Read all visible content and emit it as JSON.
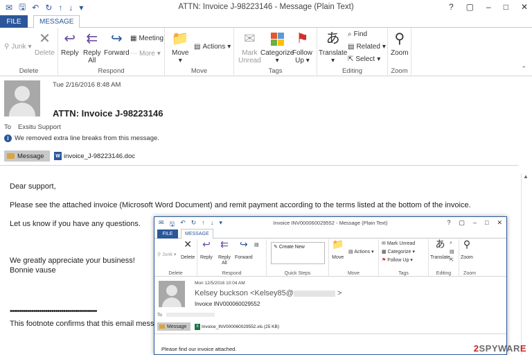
{
  "window": {
    "title": "ATTN: Invoice J-98223146 - Message (Plain Text)"
  },
  "tabs": {
    "file": "FILE",
    "message": "MESSAGE"
  },
  "window_controls": {
    "help": "?",
    "restore": "▢",
    "minimize": "–",
    "maximize": "□",
    "close": "✕"
  },
  "ribbon": {
    "delete_group": {
      "junk": "Junk",
      "delete": "Delete",
      "label": "Delete"
    },
    "respond_group": {
      "reply": "Reply",
      "reply_all_1": "Reply",
      "reply_all_2": "All",
      "forward": "Forward",
      "meeting": "Meeting",
      "more": "More",
      "label": "Respond"
    },
    "move_group": {
      "move": "Move",
      "actions": "Actions",
      "label": "Move"
    },
    "tags_group": {
      "mark_1": "Mark",
      "mark_2": "Unread",
      "categorize": "Categorize",
      "follow_1": "Follow",
      "follow_2": "Up",
      "label": "Tags"
    },
    "editing_group": {
      "translate": "Translate",
      "find": "Find",
      "related": "Related",
      "select": "Select",
      "label": "Editing"
    },
    "zoom_group": {
      "zoom": "Zoom",
      "label": "Zoom"
    }
  },
  "header": {
    "date": "Tue 2/16/2016 8:48 AM",
    "subject": "ATTN: Invoice J-98223146",
    "to_label": "To",
    "to_value": "Exsitu Support",
    "info": "We removed extra line breaks from this message.",
    "message_chip": "Message",
    "attachment": "invoice_J-98223146.doc"
  },
  "body": {
    "greeting": "Dear support,",
    "line1": "Please see the attached invoice (Microsoft Word Document) and remit payment according to the terms listed at the bottom of the invoice.",
    "line2": "Let us know if you have any questions.",
    "line3": "We greatly appreciate your business!",
    "line4": "Bonnie vause",
    "dots": "••••••••••••••••••••••••••••••••••••••••••••",
    "footnote": "This footnote confirms that this email message"
  },
  "inner": {
    "title": "Invoice INV000060029552 - Message (Plain Text)",
    "file": "FILE",
    "message": "MESSAGE",
    "junk": "Junk",
    "delete": "Delete",
    "reply": "Reply",
    "reply_all_1": "Reply",
    "reply_all_2": "All",
    "forward": "Forward",
    "create_new": "Create New",
    "move": "Move",
    "actions": "Actions",
    "mark_unread": "Mark Unread",
    "categorize": "Categorize",
    "follow_up": "Follow Up",
    "translate": "Translate",
    "zoom": "Zoom",
    "labels": {
      "delete": "Delete",
      "respond": "Respond",
      "quick_steps": "Quick Steps",
      "move": "Move",
      "tags": "Tags",
      "editing": "Editing",
      "zoom": "Zoom"
    },
    "date": "Mon 12/5/2016 10:04 AM",
    "from_name": "Kelsey buckson <Kelsey85@",
    "from_end": ">",
    "subject": "Invoice INV000060029552",
    "to_label": "To",
    "message_chip": "Message",
    "attachment": "Invoice_INV000060029552.xls (25 KB)",
    "body": "Please find our invoice attached."
  },
  "watermark": {
    "two": "2",
    "rest": "SPYWAR",
    "suffix": "E"
  }
}
